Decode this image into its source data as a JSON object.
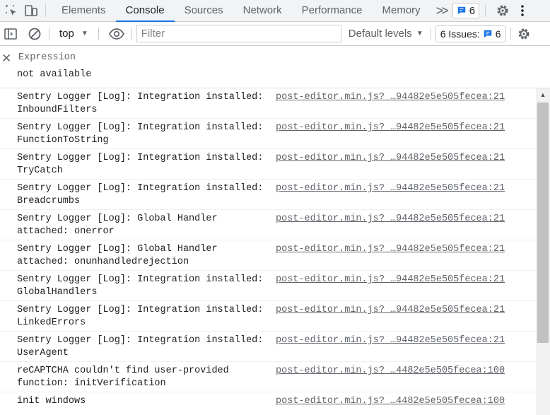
{
  "tabbar": {
    "tabs": [
      "Elements",
      "Console",
      "Sources",
      "Network",
      "Performance",
      "Memory"
    ],
    "active_tab": "Console",
    "more_label": ">>",
    "messages_count": "6"
  },
  "toolbar": {
    "context": "top",
    "filter_placeholder": "Filter",
    "levels_label": "Default levels",
    "issues_label": "6 Issues:",
    "issues_count": "6"
  },
  "expression": {
    "label": "Expression",
    "value": "not available"
  },
  "messages": [
    {
      "text": "Sentry Logger [Log]: Integration installed:\nInboundFilters",
      "source": "post-editor.min.js?_…94482e5e505fecea:21"
    },
    {
      "text": "Sentry Logger [Log]: Integration installed:\nFunctionToString",
      "source": "post-editor.min.js?_…94482e5e505fecea:21"
    },
    {
      "text": "Sentry Logger [Log]: Integration installed:\nTryCatch",
      "source": "post-editor.min.js?_…94482e5e505fecea:21"
    },
    {
      "text": "Sentry Logger [Log]: Integration installed:\nBreadcrumbs",
      "source": "post-editor.min.js?_…94482e5e505fecea:21"
    },
    {
      "text": "Sentry Logger [Log]: Global Handler\nattached: onerror",
      "source": "post-editor.min.js?_…94482e5e505fecea:21"
    },
    {
      "text": "Sentry Logger [Log]: Global Handler\nattached: onunhandledrejection",
      "source": "post-editor.min.js?_…94482e5e505fecea:21"
    },
    {
      "text": "Sentry Logger [Log]: Integration installed:\nGlobalHandlers",
      "source": "post-editor.min.js?_…94482e5e505fecea:21"
    },
    {
      "text": "Sentry Logger [Log]: Integration installed:\nLinkedErrors",
      "source": "post-editor.min.js?_…94482e5e505fecea:21"
    },
    {
      "text": "Sentry Logger [Log]: Integration installed:\nUserAgent",
      "source": "post-editor.min.js?_…94482e5e505fecea:21"
    },
    {
      "text": "reCAPTCHA couldn't find user-provided\nfunction: initVerification",
      "source": "post-editor.min.js?_…4482e5e505fecea:100"
    },
    {
      "text": "init windows",
      "source": "post-editor.min.js?_…4482e5e505fecea:100"
    }
  ],
  "icons": {
    "inspect": "inspect-element-icon",
    "device": "device-toolbar-icon",
    "message": "message-icon",
    "settings": "gear-icon",
    "more": "more-vertical-icon",
    "sidebar": "sidebar-toggle-icon",
    "clear": "clear-console-icon",
    "eye": "eye-icon",
    "close": "close-icon"
  },
  "colors": {
    "accent": "#1a73e8",
    "toolbar_bg": "#f1f3f4",
    "scroll_thumb": "#c1c1c1"
  }
}
